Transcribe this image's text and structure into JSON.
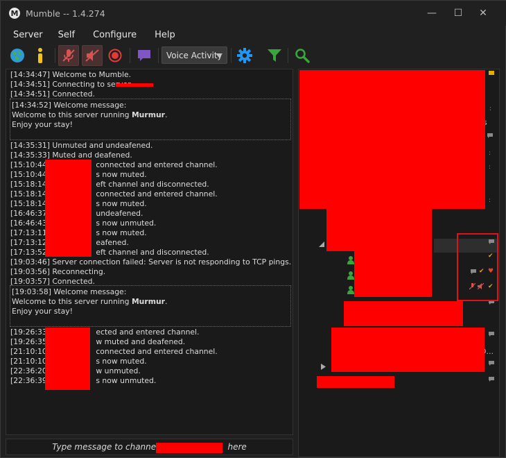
{
  "window": {
    "title": "Mumble -- 1.4.274",
    "minimize": "—",
    "maximize": "☐",
    "close": "✕"
  },
  "menu": [
    "Server",
    "Self",
    "Configure",
    "Help"
  ],
  "toolbar": {
    "transmit_mode": "Voice Activity",
    "icons": [
      "globe-icon",
      "info-icon",
      "mute-self-icon",
      "deafen-self-icon",
      "record-icon",
      "chat-bubble-icon",
      "settings-gear-icon",
      "filter-icon",
      "search-icon"
    ],
    "colors": {
      "globe": "#2e9bd6",
      "info": "#f0c419",
      "record": "#e53935",
      "chat": "#7e57c2",
      "gear": "#2196f3",
      "filter": "#3aa53a",
      "search": "#3aa53a"
    }
  },
  "log": {
    "lines_top": [
      {
        "ts": "[14:34:47]",
        "msg": "Welcome to Mumble."
      },
      {
        "ts": "[14:34:51]",
        "msg": "Connecting to server"
      },
      {
        "ts": "[14:34:51]",
        "msg": "Connected."
      }
    ],
    "welcome1": {
      "ts": "[14:34:52]",
      "l1": "Welcome message:",
      "l2a": "Welcome to this server running ",
      "l2b": "Murmur",
      "l2c": ".",
      "l3": "Enjoy your stay!"
    },
    "lines_mid": [
      {
        "ts": "[14:35:31]",
        "msg": "Unmuted and undeafened."
      },
      {
        "ts": "[14:35:33]",
        "msg": "Muted and deafened."
      },
      {
        "ts": "[15:10:44]",
        "msg": "connected and entered channel."
      },
      {
        "ts": "[15:10:44]",
        "msg": "s now muted."
      },
      {
        "ts": "[15:18:14]",
        "msg": "eft channel and disconnected."
      },
      {
        "ts": "[15:18:14]",
        "msg": "connected and entered channel."
      },
      {
        "ts": "[15:18:14]",
        "msg": "s now muted."
      },
      {
        "ts": "[16:46:37]",
        "msg": "undeafened."
      },
      {
        "ts": "[16:46:43]",
        "msg": "s now unmuted."
      },
      {
        "ts": "[17:13:11]",
        "msg": "s now muted."
      },
      {
        "ts": "[17:13:12]",
        "msg": "eafened."
      },
      {
        "ts": "[17:13:52]",
        "msg": "eft channel and disconnected."
      },
      {
        "ts": "[19:03:46]",
        "msg": "Server connection failed: Server is not responding to TCP pings."
      },
      {
        "ts": "[19:03:56]",
        "msg": "Reconnecting."
      },
      {
        "ts": "[19:03:57]",
        "msg": "Connected."
      }
    ],
    "welcome2": {
      "ts": "[19:03:58]",
      "l1": "Welcome message:",
      "l2a": "Welcome to this server running ",
      "l2b": "Murmur",
      "l2c": ".",
      "l3": "Enjoy your stay!"
    },
    "lines_bottom": [
      {
        "ts": "[19:26:33]",
        "msg": "ected and entered channel."
      },
      {
        "ts": "[19:26:35]",
        "msg": "w muted and deafened."
      },
      {
        "ts": "[21:10:10]",
        "msg": "connected and entered channel."
      },
      {
        "ts": "[21:10:10]",
        "msg": "s now muted."
      },
      {
        "ts": "[22:36:20]",
        "msg": "w unmuted."
      },
      {
        "ts": "[22:36:39]",
        "msg": "s now unmuted."
      }
    ]
  },
  "chat": {
    "prefix": "Type message to channel",
    "suffix": "here"
  },
  "tree": {
    "fragments": [
      "s",
      "D..."
    ]
  },
  "colors": {
    "redaction": "#ff0000",
    "highlight_box": "#e0131a",
    "user_green": "#3aa53a",
    "check": "#e6a020"
  }
}
